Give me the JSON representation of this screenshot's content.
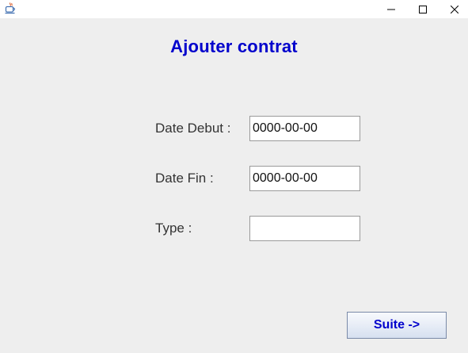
{
  "window": {
    "title": "",
    "app_icon": "java-coffee-cup-icon",
    "controls": {
      "minimize": "minimize-icon",
      "maximize": "maximize-icon",
      "close": "close-icon"
    }
  },
  "form": {
    "title": "Ajouter contrat",
    "fields": [
      {
        "label": "Date Debut :",
        "value": "0000-00-00",
        "placeholder": ""
      },
      {
        "label": "Date Fin :",
        "value": "0000-00-00",
        "placeholder": ""
      },
      {
        "label": "Type :",
        "value": "",
        "placeholder": ""
      }
    ],
    "next_button_label": "Suite ->"
  },
  "colors": {
    "accent": "#0000cc",
    "background": "#eeeeee",
    "titlebar": "#ffffff"
  }
}
